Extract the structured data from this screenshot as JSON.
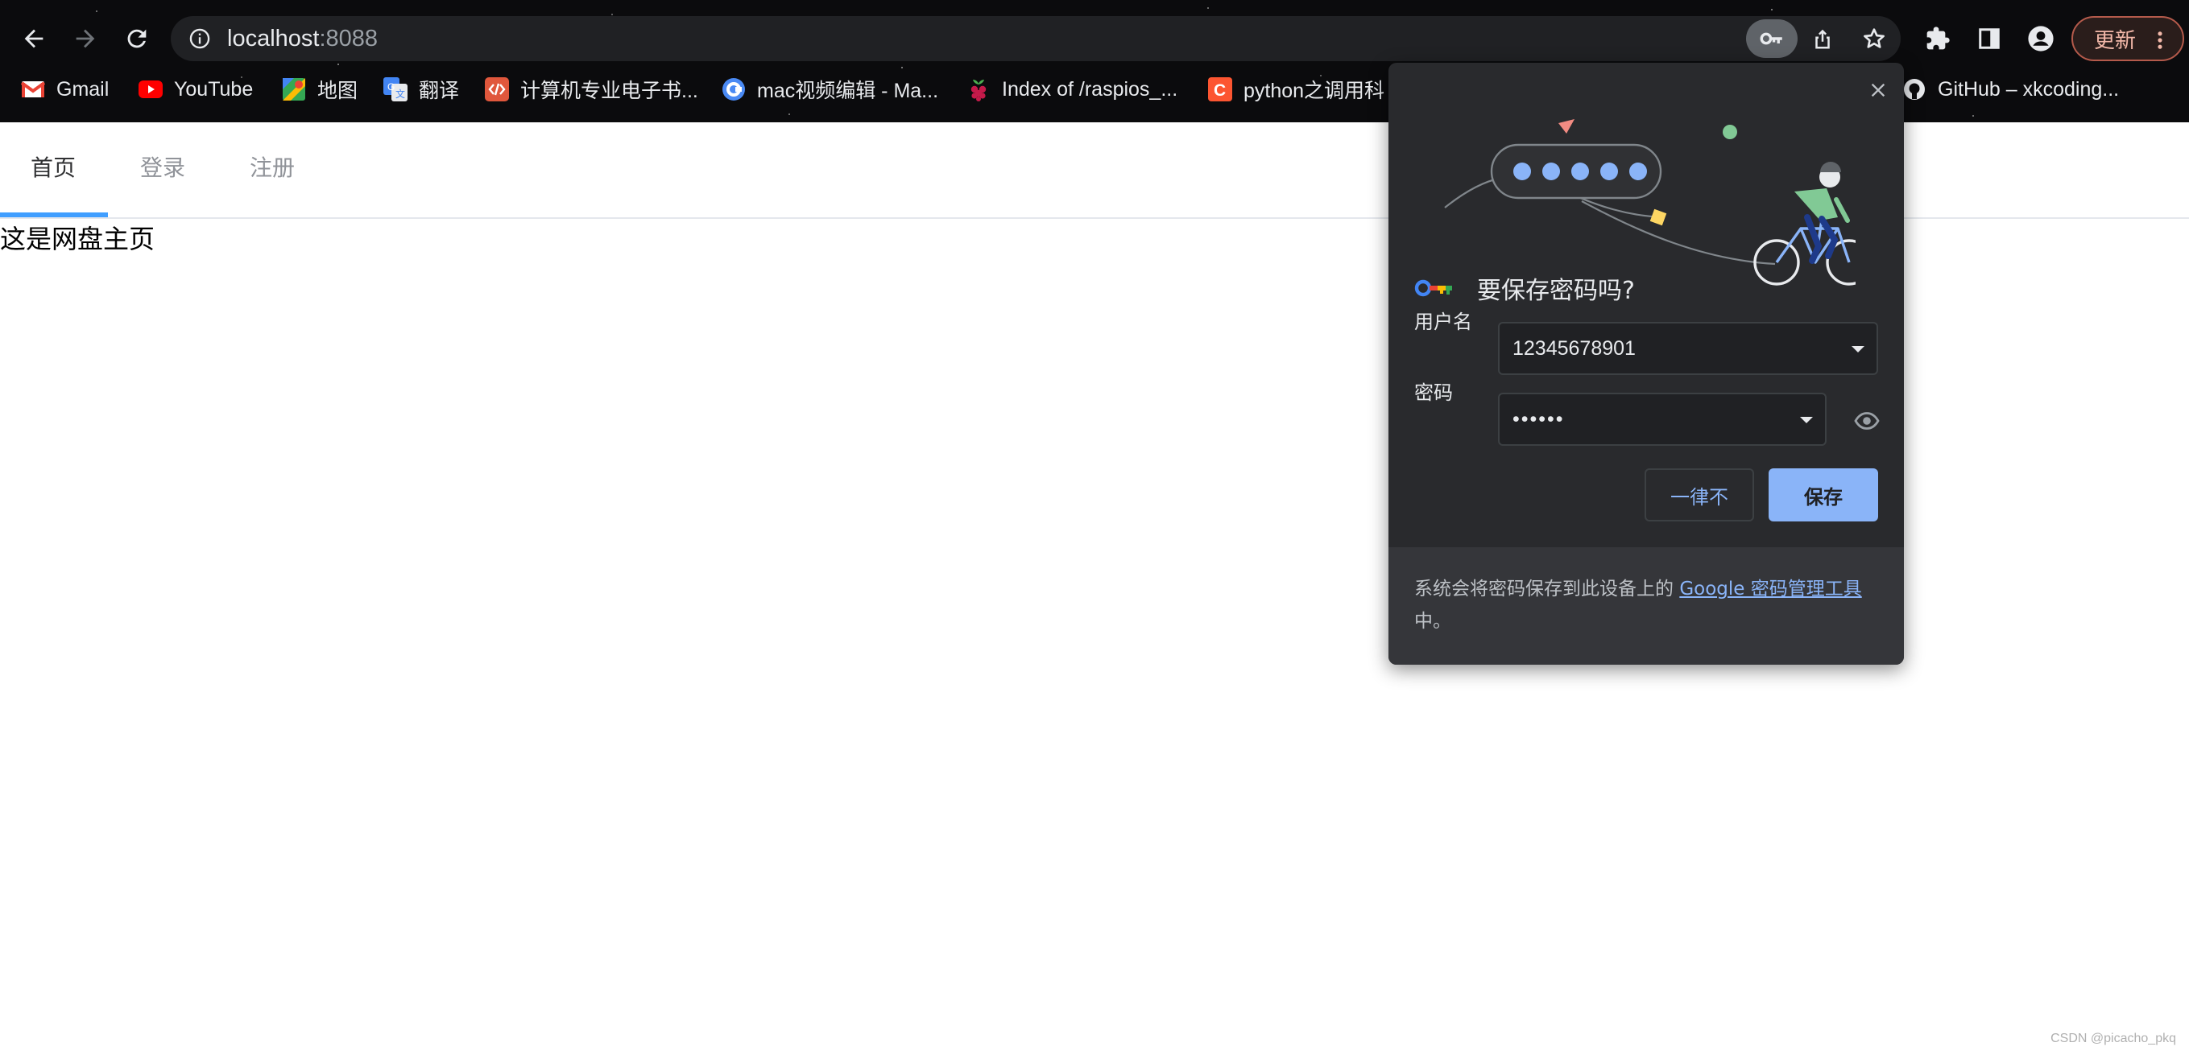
{
  "browser": {
    "url_host": "localhost",
    "url_port": ":8088",
    "update_label": "更新",
    "bookmarks": [
      {
        "label": "Gmail",
        "icon": "gmail-icon"
      },
      {
        "label": "YouTube",
        "icon": "youtube-icon"
      },
      {
        "label": "地图",
        "icon": "maps-icon"
      },
      {
        "label": "翻译",
        "icon": "translate-icon"
      },
      {
        "label": "计算机专业电子书...",
        "icon": "code-icon"
      },
      {
        "label": "mac视频编辑 - Ma...",
        "icon": "circle-c-icon"
      },
      {
        "label": "Index of /raspios_...",
        "icon": "raspberry-icon"
      },
      {
        "label": "python之调用科",
        "icon": "csdn-icon"
      },
      {
        "label": "GitHub – xkcoding...",
        "icon": "github-icon"
      }
    ]
  },
  "page": {
    "tabs": [
      {
        "label": "首页",
        "active": true
      },
      {
        "label": "登录",
        "active": false
      },
      {
        "label": "注册",
        "active": false
      }
    ],
    "content_text": "这是网盘主页",
    "watermark": "CSDN @picacho_pkq"
  },
  "save_password": {
    "title": "要保存密码吗?",
    "username_label": "用户名",
    "username_value": "12345678901",
    "password_label": "密码",
    "password_value": "••••••",
    "never_label": "一律不",
    "save_label": "保存",
    "footer_text": "系统会将密码保存到此设备上的 ",
    "footer_link": "Google 密码管理工具",
    "footer_tail": "中。"
  },
  "colors": {
    "accent": "#8ab4f8",
    "tab_indicator": "#409eff",
    "bubble_bg": "#292a2d"
  }
}
